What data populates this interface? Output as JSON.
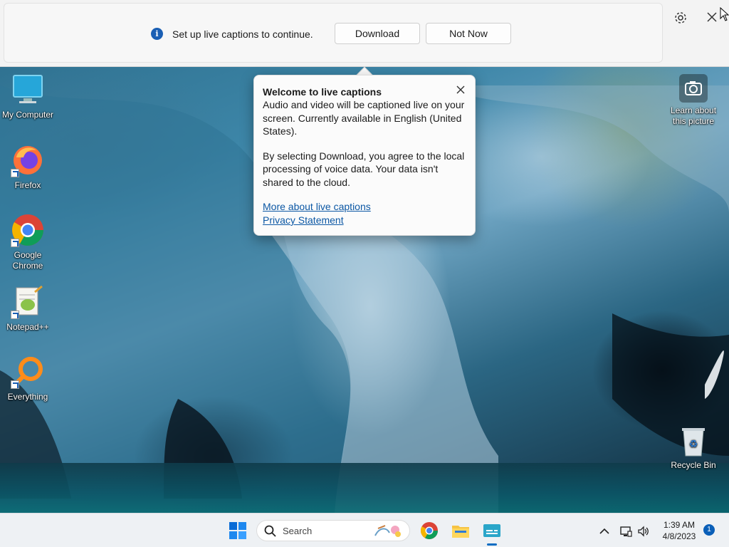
{
  "caption_bar": {
    "message": "Set up live captions to continue.",
    "download_label": "Download",
    "not_now_label": "Not Now",
    "icons": [
      "info-icon",
      "gear-icon",
      "close-icon"
    ]
  },
  "popup": {
    "title": "Welcome to live captions",
    "body1": "Audio and video will be captioned live on your screen. Currently available in English (United States).",
    "body2": "By selecting Download, you agree to the local processing of voice data. Your data isn't shared to the cloud.",
    "link1": "More about live captions",
    "link2": "Privacy Statement"
  },
  "desktop": {
    "icons": [
      {
        "label": "My Computer",
        "icon": "monitor-icon"
      },
      {
        "label": "Firefox",
        "icon": "firefox-icon"
      },
      {
        "label": "Google Chrome",
        "icon": "chrome-icon"
      },
      {
        "label": "Notepad++",
        "icon": "notepadpp-icon"
      },
      {
        "label": "Everything",
        "icon": "everything-search-icon"
      },
      {
        "label": "Learn about this picture",
        "icon": "camera-icon"
      },
      {
        "label": "Recycle Bin",
        "icon": "recycle-bin-icon"
      }
    ]
  },
  "taskbar": {
    "search_placeholder": "Search",
    "time": "1:39 AM",
    "date": "4/8/2023",
    "notification_count": "1",
    "apps": [
      "start-icon",
      "chrome-icon",
      "file-explorer-icon",
      "live-captions-icon"
    ],
    "tray": [
      "chevron-up-icon",
      "network-icon",
      "volume-icon"
    ]
  },
  "colors": {
    "accent": "#0a5fb8",
    "link": "#0b57a4",
    "caption_bar_bg": "#f3f3f3",
    "taskbar_bg": "#eef1f4"
  }
}
